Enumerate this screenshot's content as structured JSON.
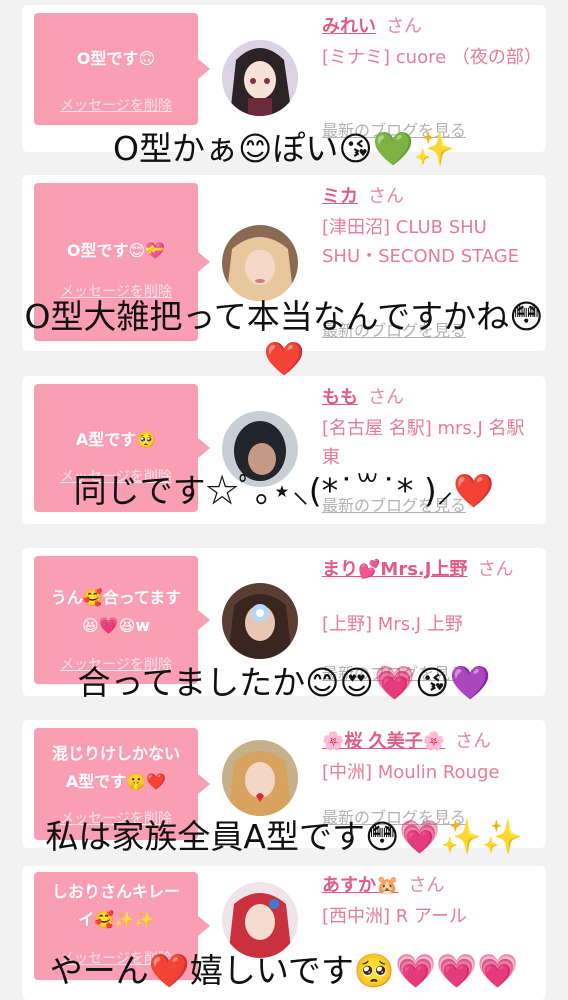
{
  "cards": [
    {
      "bubble": [
        "O型です🙃"
      ],
      "delete": "メッセージを削除",
      "name": "みれい",
      "san": "さん",
      "shop": "[ミナミ] cuore （夜の部）",
      "blog": "最新のブログを見る",
      "avatar": "anime-avatar"
    },
    {
      "bubble": [
        "O型です😊💝"
      ],
      "delete": "メッセージを削除",
      "name": "ミカ",
      "san": "さん",
      "shop": "[津田沼] CLUB SHU SHU・SECOND STAGE",
      "blog": "最新のブログを見る",
      "avatar": "blonde-avatar"
    },
    {
      "bubble": [
        "A型です🥺"
      ],
      "delete": "メッセージを削除",
      "name": "もも",
      "san": "さん",
      "shop": "[名古屋 名駅] mrs.J 名駅東",
      "blog": "最新のブログを見る",
      "avatar": "dark-hair-avatar"
    },
    {
      "bubble": [
        "うん🥰合ってます",
        "😆💗😆w"
      ],
      "delete": "メッセージを削除",
      "name": "まり💕Mrs.J上野",
      "san": "さん",
      "shop": "[上野] Mrs.J 上野",
      "blog": "最新のブログを見る",
      "avatar": "flower-face-avatar"
    },
    {
      "bubble": [
        "混じりけしかない",
        "A型です🤫❤️"
      ],
      "delete": "メッセージを削除",
      "name": "🌸桜 久美子🌸",
      "san": "さん",
      "shop": "[中洲] Moulin Rouge",
      "blog": "最新のブログを見る",
      "avatar": "heart-avatar"
    },
    {
      "bubble": [
        "しおりさんキレー",
        "イ🥰✨✨"
      ],
      "delete": "メッセージを削除",
      "name": "あすか🐹",
      "san": "さん",
      "shop": "[西中洲] R アール",
      "blog": "最新のブログを見る",
      "avatar": "red-hair-avatar"
    }
  ],
  "captions": [
    "O型かぁ😊ぽい😘💚✨",
    "O型大雑把って本当なんですかね😳",
    "❤️",
    "同じです☆ﾟ｡⋆⸜(*˙꒳˙* )⸝❤️",
    "合ってましたか😊😍💗😘💜",
    "私は家族全員A型です😳💗✨✨",
    "やーん❤️嬉しいです🥺💗💗💗"
  ]
}
